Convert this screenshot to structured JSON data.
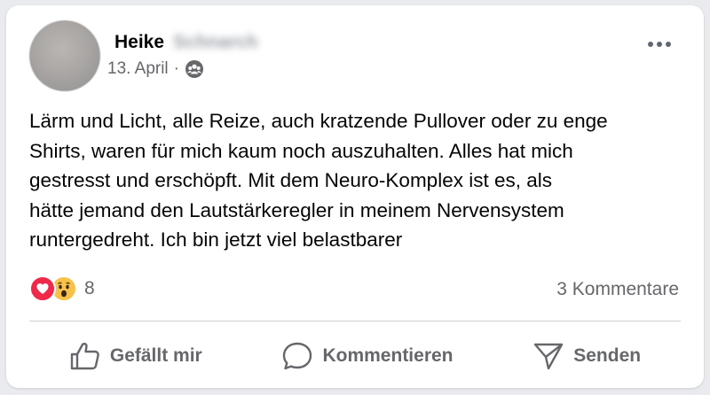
{
  "post": {
    "author_first": "Heike",
    "author_last_blurred": "Schnarch",
    "date": "13. April",
    "separator": "·",
    "audience_icon": "group-icon",
    "text": "Lärm und Licht, alle Reize, auch kratzende Pullover oder zu enge\nShirts, waren für mich kaum noch auszuhalten. Alles hat mich\ngestresst und erschöpft. Mit dem Neuro-Komplex ist es, als\nhätte jemand den Lautstärkeregler in meinem Nervensystem\nruntergedreht. Ich bin jetzt viel belastbarer"
  },
  "reactions": {
    "icons": [
      "love-icon",
      "wow-icon"
    ],
    "count": "8"
  },
  "comments": {
    "label": "3 Kommentare"
  },
  "actions": {
    "like": "Gefällt mir",
    "comment": "Kommentieren",
    "share": "Senden"
  },
  "colors": {
    "love": "#f0284a",
    "wow": "#f7c24a",
    "secondary_text": "#65676b"
  }
}
